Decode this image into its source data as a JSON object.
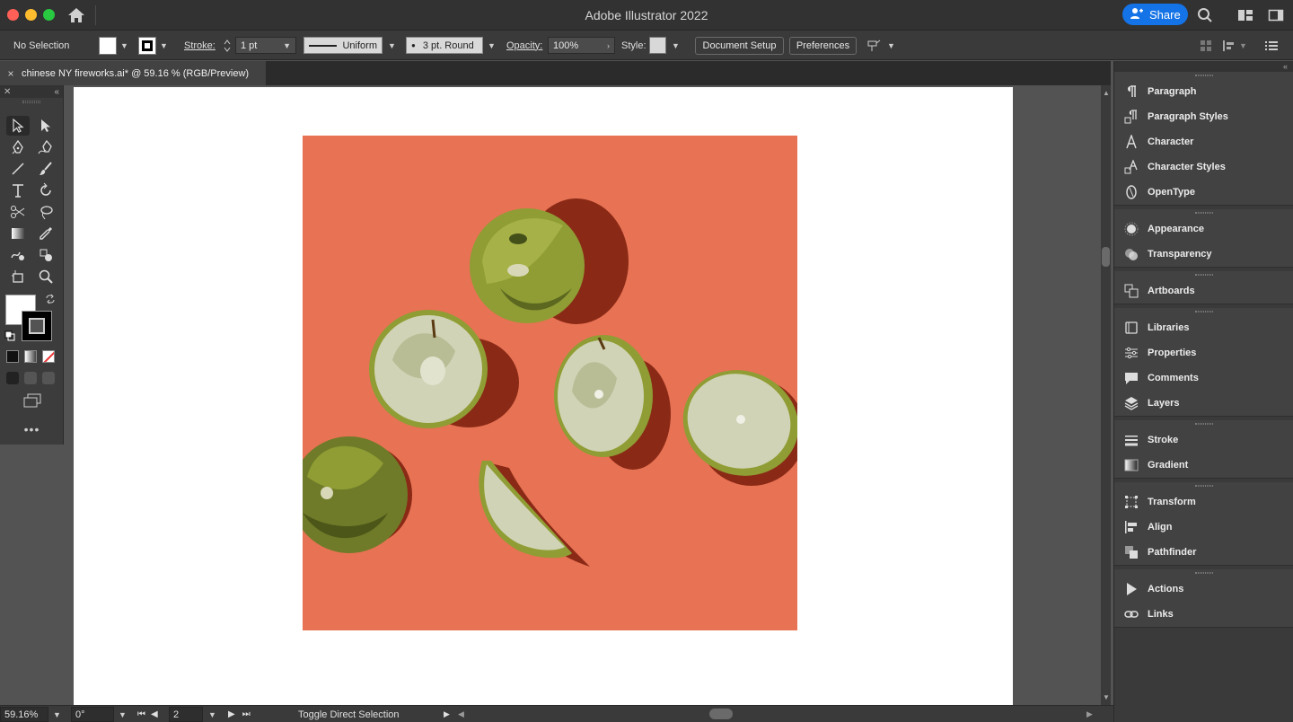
{
  "titlebar": {
    "app_title": "Adobe Illustrator 2022",
    "share_label": "Share"
  },
  "controlbar": {
    "selection": "No Selection",
    "stroke_label": "Stroke:",
    "stroke_weight": "1 pt",
    "profile": "Uniform",
    "brush": "3 pt. Round",
    "opacity_label": "Opacity:",
    "opacity_value": "100%",
    "style_label": "Style:",
    "document_setup": "Document Setup",
    "preferences": "Preferences"
  },
  "document": {
    "tab_title": "chinese NY fireworks.ai* @ 59.16 % (RGB/Preview)",
    "close_glyph": "×",
    "artboard_color": "#e87254"
  },
  "panels": {
    "groups": [
      {
        "items": [
          {
            "label": "Paragraph",
            "icon": "paragraph-icon"
          },
          {
            "label": "Paragraph Styles",
            "icon": "paragraph-styles-icon"
          },
          {
            "label": "Character",
            "icon": "character-icon"
          },
          {
            "label": "Character Styles",
            "icon": "character-styles-icon"
          },
          {
            "label": "OpenType",
            "icon": "opentype-icon"
          }
        ]
      },
      {
        "items": [
          {
            "label": "Appearance",
            "icon": "appearance-icon"
          },
          {
            "label": "Transparency",
            "icon": "transparency-icon"
          }
        ]
      },
      {
        "items": [
          {
            "label": "Artboards",
            "icon": "artboards-icon"
          }
        ]
      },
      {
        "items": [
          {
            "label": "Libraries",
            "icon": "libraries-icon"
          },
          {
            "label": "Properties",
            "icon": "properties-icon"
          },
          {
            "label": "Comments",
            "icon": "comments-icon"
          },
          {
            "label": "Layers",
            "icon": "layers-icon"
          }
        ]
      },
      {
        "items": [
          {
            "label": "Stroke",
            "icon": "stroke-icon"
          },
          {
            "label": "Gradient",
            "icon": "gradient-icon"
          }
        ]
      },
      {
        "items": [
          {
            "label": "Transform",
            "icon": "transform-icon"
          },
          {
            "label": "Align",
            "icon": "align-icon"
          },
          {
            "label": "Pathfinder",
            "icon": "pathfinder-icon"
          }
        ]
      },
      {
        "items": [
          {
            "label": "Actions",
            "icon": "actions-icon"
          },
          {
            "label": "Links",
            "icon": "links-icon"
          }
        ]
      }
    ]
  },
  "statusbar": {
    "zoom": "59.16%",
    "rotation": "0°",
    "artboard_number": "2",
    "status_text": "Toggle Direct Selection"
  }
}
